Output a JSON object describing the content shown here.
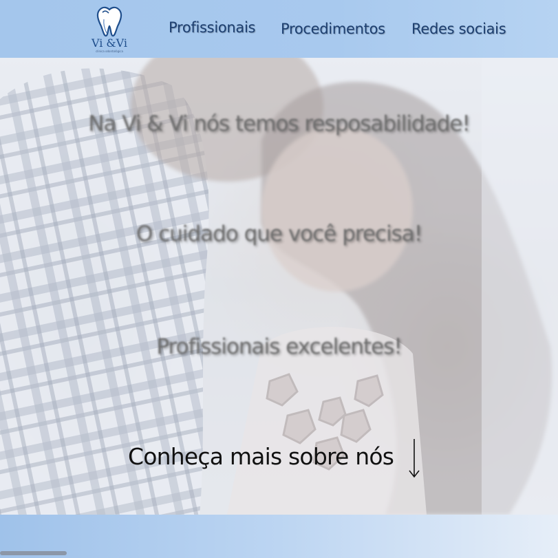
{
  "header": {
    "logo": {
      "name": "Vi &Vi",
      "subtitle": "clínica odontológica",
      "icon": "tooth-icon"
    },
    "nav": [
      {
        "label": "Profissionais"
      },
      {
        "label": "Procedimentos"
      },
      {
        "label": "Redes sociais"
      }
    ]
  },
  "hero": {
    "background": "smiling-couple-photo",
    "taglines": [
      "Na Vi & Vi nós temos resposabilidade!",
      "O cuidado que você precisa!",
      "Profissionais excelentes!"
    ],
    "cta_label": "Conheça mais sobre nós",
    "cta_icon": "arrow-down-icon"
  },
  "colors": {
    "header_bg": "#a4c6ec",
    "nav_text": "#1d3f70",
    "brand_blue": "#1f4e8c",
    "footer_bg": "#9fc2ea"
  }
}
